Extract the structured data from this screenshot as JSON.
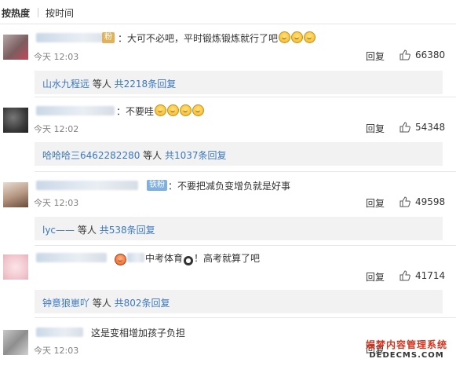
{
  "tabs": {
    "hot": "按热度",
    "time": "按时间"
  },
  "comments": [
    {
      "badge": "粉",
      "text": "大可不必吧，平时锻炼锻炼就行了吧",
      "time": "今天 12:03",
      "reply_label": "回复",
      "likes": "66380",
      "subreply": {
        "user": "山水九程远",
        "mid": " 等人 ",
        "link": "共2218条回复"
      }
    },
    {
      "text": "不要哇",
      "time": "今天 12:02",
      "reply_label": "回复",
      "likes": "54348",
      "subreply": {
        "user": "哈哈哈三6462282280",
        "mid": " 等人 ",
        "link": "共1037条回复"
      }
    },
    {
      "badge": "铁粉",
      "text": "不要把减负变增负就是好事",
      "time": "今天 12:03",
      "reply_label": "回复",
      "likes": "49598",
      "subreply": {
        "user": "lyc——",
        "mid": " 等人 ",
        "link": "共538条回复"
      }
    },
    {
      "text_a": "中考体育",
      "text_b": "！高考就算了吧",
      "reply_label": "回复",
      "likes": "41714",
      "subreply": {
        "user": "钟意狼崽吖",
        "mid": " 等人 ",
        "link": "共802条回复"
      }
    },
    {
      "text": "这是变相增加孩子负担",
      "time": "今天 12:03",
      "reply_label": "回复"
    }
  ],
  "watermark": {
    "line1": "娱梦内容管理系统",
    "line2": "DEDECMS.COM"
  },
  "icons": {
    "like": "thumb-up-icon",
    "emoji_laugh": "laugh-cry-emoji-icon",
    "emoji_angry": "angry-emoji-icon"
  },
  "colors": {
    "link": "#3b78c2",
    "meta": "#808080",
    "subreply_bg": "#f2f2f2"
  }
}
